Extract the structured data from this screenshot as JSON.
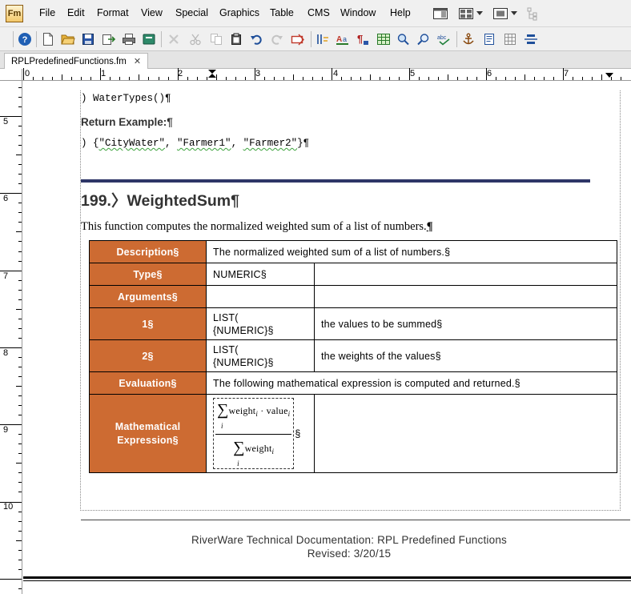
{
  "app": {
    "logo": "Fm",
    "menu": [
      "File",
      "Edit",
      "Format",
      "View",
      "Special",
      "Graphics",
      "Table",
      "CMS",
      "Window",
      "Help"
    ]
  },
  "toolbar_icons": [
    "help-icon",
    "new-document-icon",
    "open-folder-icon",
    "save-icon",
    "export-icon",
    "print-icon",
    "book-icon",
    "delete-icon",
    "cut-icon",
    "copy-icon",
    "paste-icon",
    "undo-icon",
    "redo-icon",
    "arrow-right-icon",
    "paragraph-format-icon",
    "character-format-icon",
    "paragraph-designer-icon",
    "table-icon",
    "find-icon",
    "zoom-icon",
    "spell-check-icon",
    "anchor-icon",
    "frame-icon",
    "grid-icon",
    "align-icon"
  ],
  "tab": {
    "label": "RPLPredefinedFunctions.fm",
    "close": "✕"
  },
  "ruler": {
    "h_numbers": [
      "0",
      "1",
      "2",
      "3",
      "4",
      "5",
      "6",
      "7"
    ],
    "v_numbers": [
      "5",
      "6",
      "7",
      "8",
      "9",
      "10"
    ]
  },
  "document": {
    "code_line_1": ")   WaterTypes()¶",
    "return_example_label": "Return Example:¶",
    "code_line_2_prefix": ")   {",
    "code_line_2_items": [
      "\"CityWater\"",
      "\"Farmer1\"",
      "\"Farmer2\""
    ],
    "code_line_2_suffix": "}¶",
    "heading": "199.〉WeightedSum¶",
    "intro": "This function computes the normalized weighted sum of a list of numbers.",
    "intro_mark": "¶",
    "table": {
      "description_label": "Description§",
      "description_value": "The normalized weighted sum of a list of numbers.§",
      "type_label": "Type§",
      "type_value": "NUMERIC§",
      "arguments_label": "Arguments§",
      "arg1_label": "1§",
      "arg1_type_line1": "LIST(",
      "arg1_type_line2": "{NUMERIC}§",
      "arg1_desc": "the values to be summed§",
      "arg2_label": "2§",
      "arg2_type_line1": "LIST(",
      "arg2_type_line2": "{NUMERIC}§",
      "arg2_desc": "the weights of the values§",
      "evaluation_label": "Evaluation§",
      "evaluation_value": "The following mathematical expression is computed and returned.§",
      "math_label_line1": "Mathematical",
      "math_label_line2": "Expression§",
      "math": {
        "sigma": "∑",
        "index": "i",
        "numerator_term": "weight",
        "dot": "·",
        "numerator_term2": "value",
        "denominator_term": "weight",
        "end_mark": "§"
      }
    },
    "footer_title": "RiverWare Technical Documentation: RPL Predefined Functions",
    "footer_date": "Revised: 3/20/15"
  }
}
